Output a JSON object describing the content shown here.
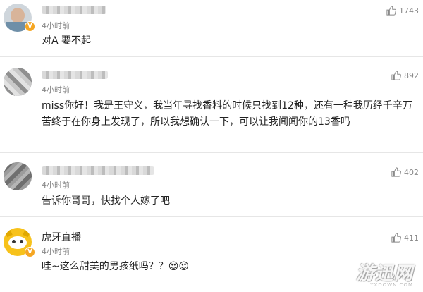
{
  "comments": [
    {
      "name": "",
      "time": "4小时前",
      "text": "对A  要不起",
      "likes": "1743"
    },
    {
      "name": "",
      "time": "4小时前",
      "text": "miss你好！我是王守义，我当年寻找香料的时候只找到12种，还有一种我历经千辛万苦终于在你身上发现了，所以我想确认一下，可以让我闻闻你的13香吗",
      "likes": "892"
    },
    {
      "name": "",
      "time": "4小时前",
      "text": "告诉你哥哥，快找个人嫁了吧",
      "likes": "402"
    },
    {
      "name": "虎牙直播",
      "time": "4小时前",
      "text": "哇~这么甜美的男孩纸吗？？😍😍",
      "likes": "411"
    }
  ],
  "watermark": {
    "main": "游迅网",
    "sub": "YXDOWN.COM"
  },
  "colors": {
    "badge": "#f5a623",
    "huya_yellow": "#f7c21b"
  }
}
